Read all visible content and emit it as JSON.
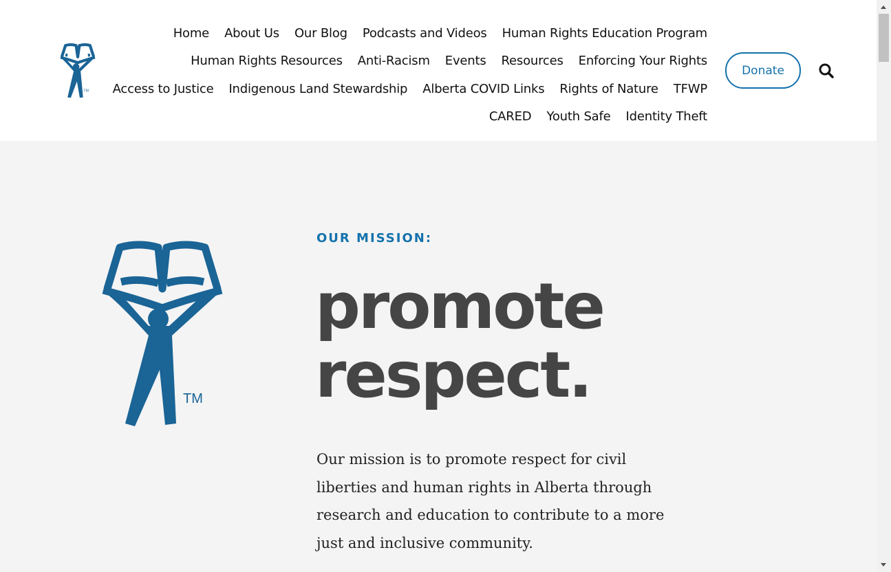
{
  "colors": {
    "brand_blue": "#1472ad",
    "logo_blue": "#1a6496",
    "headline_gray": "#454545",
    "hero_background": "#f4f4f4"
  },
  "header": {
    "logo_icon": "book-figure-logo",
    "logo_trademark": "TM",
    "nav_rows": [
      [
        "Home",
        "About Us",
        "Our Blog",
        "Podcasts and Videos",
        "Human Rights Education Program"
      ],
      [
        "Human Rights Resources",
        "Anti-Racism",
        "Events",
        "Resources",
        "Enforcing Your Rights"
      ],
      [
        "Access to Justice",
        "Indigenous Land Stewardship",
        "Alberta COVID Links",
        "Rights of Nature",
        "TFWP"
      ],
      [
        "CARED",
        "Youth Safe",
        "Identity Theft"
      ]
    ],
    "donate_label": "Donate",
    "search_icon": "search-icon"
  },
  "hero": {
    "logo_icon": "book-figure-logo",
    "logo_trademark": "TM",
    "eyebrow": "OUR MISSION:",
    "headline_line1": "promote",
    "headline_line2": "respect.",
    "body": "Our mission is to promote respect for civil liberties and human rights in Alberta through research and education to contribute to a more just and inclusive community."
  }
}
